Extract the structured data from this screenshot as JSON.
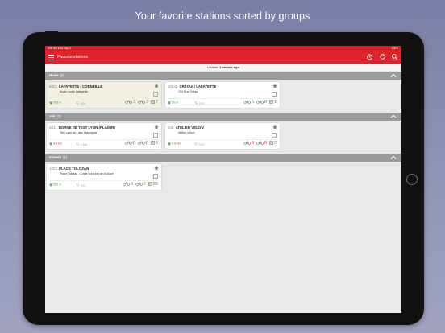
{
  "headline": "Your favorite stations sorted by groups",
  "status_bar": {
    "left": "9:56 AM   Wed May 3",
    "right": "100%"
  },
  "appbar": {
    "title": "Favorite stations"
  },
  "update": {
    "prefix": "Update:",
    "value": "1 minute ago"
  },
  "groups": [
    {
      "name": "Home",
      "count": "(2)",
      "stations": [
        {
          "num": "8001",
          "name": "LAFAYETTE / CORNEILLE",
          "address": "Angle cours Lafayette",
          "distance": "203 m",
          "time": "9:20",
          "bikes": "3",
          "ebikes": "3",
          "docks": "7",
          "highlighted": true
        },
        {
          "num": "10033",
          "name": "CRÉQUI / LAFAYETTE",
          "address": "153 Rue Créqui",
          "distance": "56 m",
          "time": "9:20",
          "bikes": "6",
          "ebikes": "8",
          "docks": "1",
          "highlighted": false
        }
      ]
    },
    {
      "name": "Job",
      "count": "(2)",
      "stations": [
        {
          "num": "2011",
          "name": "BORNE DE TEST LYON (PLAISIR)",
          "address": "Test Lyon au Labo Maurepas",
          "distance": "4.9 km",
          "time": "1 day",
          "bikes": "0",
          "ebikes": "0",
          "docks": "6",
          "highlighted": false
        },
        {
          "num": "555",
          "name": "ATELIER VÉLO'V",
          "address": "Atelier Velo'v",
          "distance": "4.9 km",
          "time": "9:20",
          "bikes": "0",
          "ebikes": "0",
          "docks": "2",
          "highlighted": false
        }
      ]
    },
    {
      "name": "Friends",
      "count": "(1)",
      "stations": [
        {
          "num": "1023",
          "name": "PLACE TOLOZAN",
          "address": "Place Tolozan - Angle nord-est de la place",
          "distance": "953 m",
          "time": "9:21",
          "bikes": "6",
          "ebikes": "2",
          "docks": "26",
          "highlighted": false
        }
      ]
    }
  ],
  "colors": {
    "accent": "#e0222d",
    "available": "#3a9a3a",
    "empty": "#d8232d",
    "low": "#e08a00"
  },
  "icons": {
    "menu": "menu-icon",
    "alarm": "alarm-clock-icon",
    "refresh": "refresh-icon",
    "search": "search-icon",
    "favorite": "star-icon",
    "collapse": "chevron-up-icon"
  }
}
